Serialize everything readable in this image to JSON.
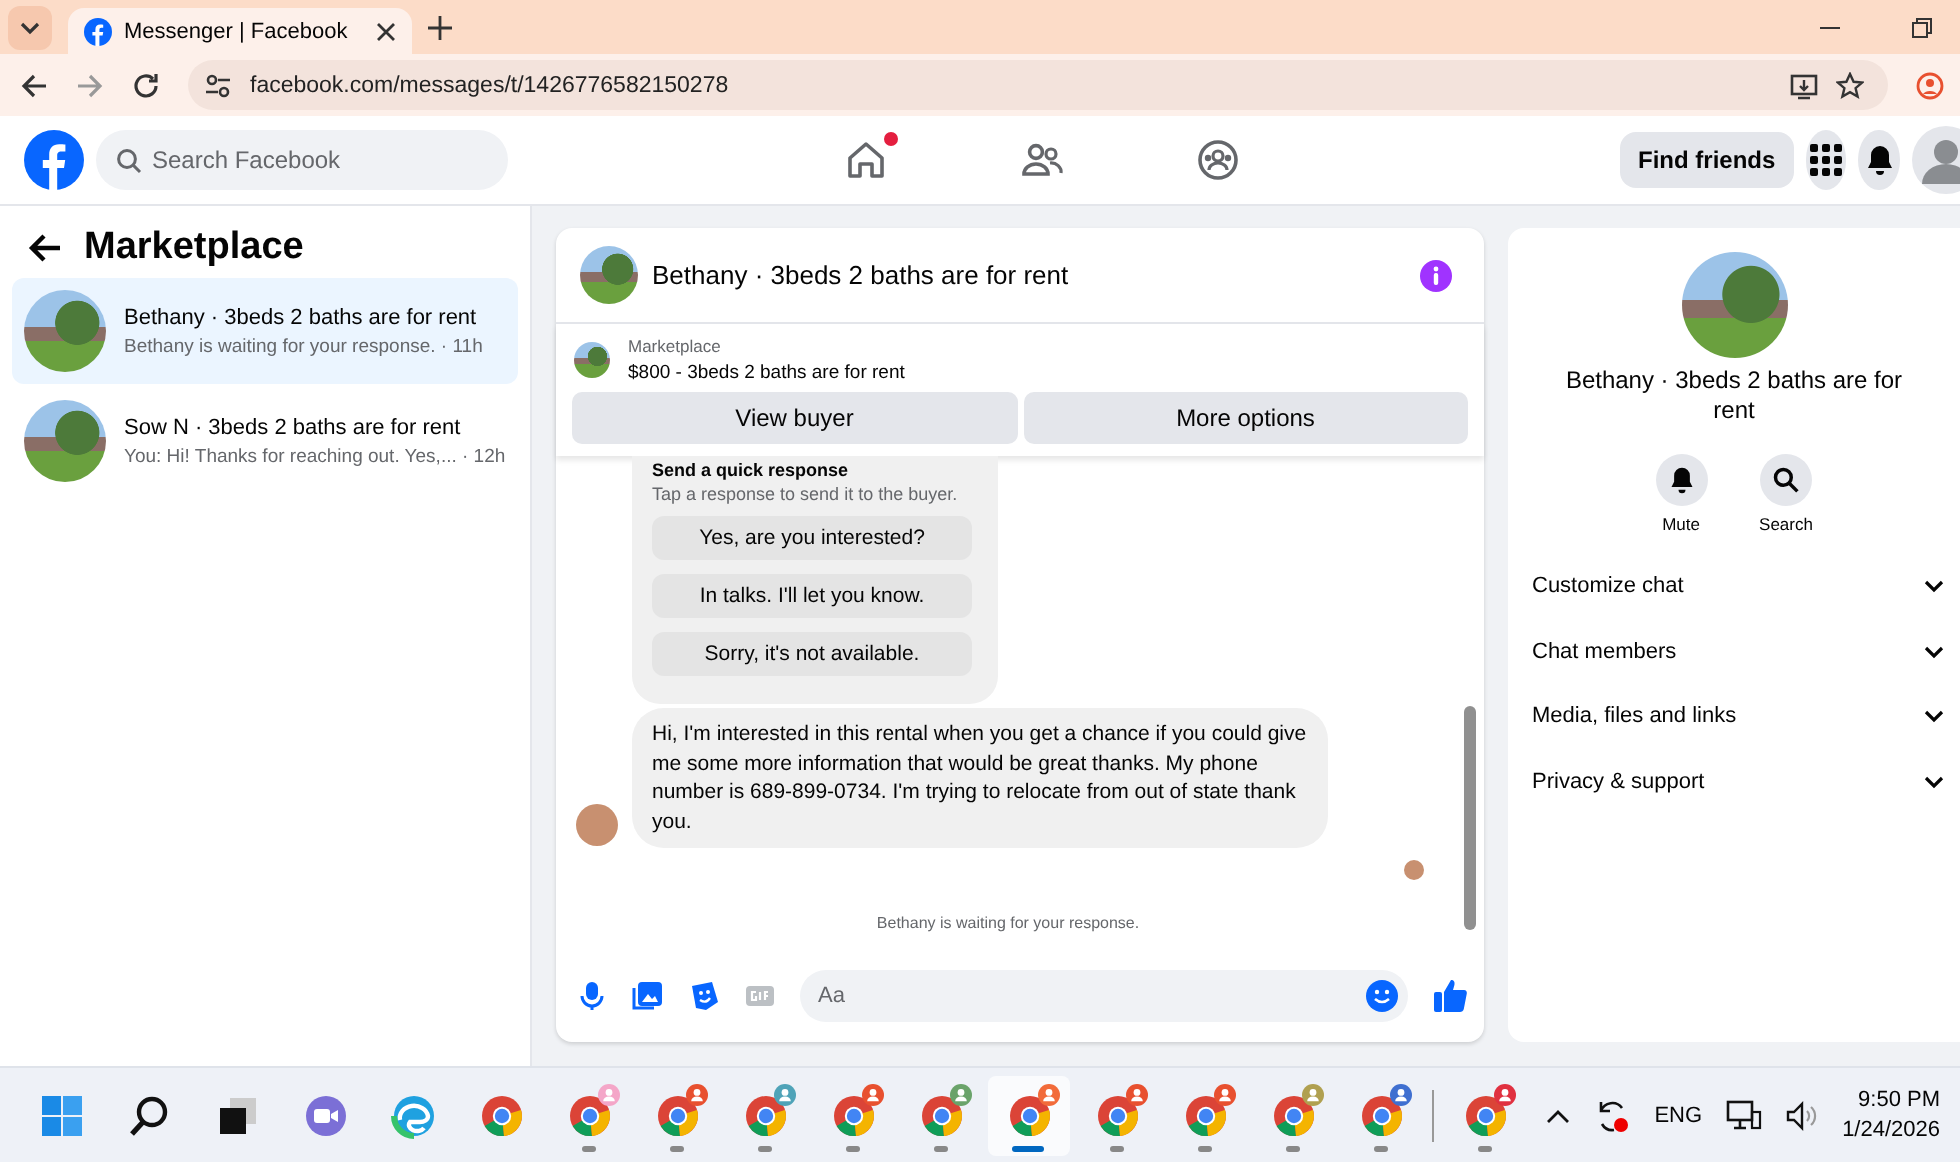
{
  "browser": {
    "tab": {
      "title": "Messenger | Facebook"
    },
    "url": "facebook.com/messages/t/1426776582150278"
  },
  "header": {
    "search": {
      "placeholder": "Search Facebook"
    },
    "nav": [
      {
        "kind": "home",
        "notification": true
      },
      {
        "kind": "friends",
        "notification": false
      },
      {
        "kind": "groups",
        "notification": false
      }
    ],
    "find_friends": "Find friends"
  },
  "sidebar": {
    "title": "Marketplace",
    "conversations": [
      {
        "name": "Bethany · 3beds 2 baths are for rent",
        "preview": "Bethany is waiting for your response. · 11h",
        "selected": true
      },
      {
        "name": "Sow N · 3beds 2 baths are for rent",
        "preview": "You: Hi! Thanks for reaching out. Yes,... · 12h",
        "selected": false
      }
    ]
  },
  "chat": {
    "title": "Bethany · 3beds 2 baths are for rent",
    "listing": {
      "label": "Marketplace",
      "item": "$800 - 3beds 2 baths are for rent",
      "buttons": [
        "View buyer",
        "More options"
      ]
    },
    "quick_response": {
      "title": "Send a quick response",
      "hint": "Tap a response to send it to the buyer.",
      "options": [
        "Yes, are you interested?",
        "In talks. I'll let you know.",
        "Sorry, it's not available."
      ]
    },
    "message": "Hi, I'm interested in this rental when you get a chance if you could give me some more information that would be great thanks. My phone number is 689-899-0734. I'm trying to relocate from out of state thank you.",
    "status": "Bethany is waiting for your response.",
    "composer": {
      "placeholder": "Aa"
    }
  },
  "details": {
    "title": "Bethany · 3beds 2 baths are for rent",
    "actions": [
      {
        "kind": "mute",
        "label": "Mute"
      },
      {
        "kind": "search",
        "label": "Search"
      }
    ],
    "sections": [
      {
        "label": "Customize chat",
        "expanded": false
      },
      {
        "label": "Chat members",
        "expanded": false
      },
      {
        "label": "Media, files and links",
        "expanded": false
      },
      {
        "label": "Privacy & support",
        "expanded": false
      }
    ]
  },
  "taskbar": {
    "apps": [
      {
        "kind": "windows",
        "running": false,
        "selected": false
      },
      {
        "kind": "search",
        "running": false,
        "selected": false
      },
      {
        "kind": "taskview",
        "running": false,
        "selected": false
      },
      {
        "kind": "teams",
        "running": false,
        "selected": false
      },
      {
        "kind": "edge",
        "running": false,
        "selected": false
      },
      {
        "kind": "chrome",
        "running": false,
        "selected": false
      },
      {
        "kind": "chrome-profile",
        "color": "#f4a6c8",
        "running": true,
        "selected": false
      },
      {
        "kind": "chrome-profile",
        "color": "#e8502f",
        "running": true,
        "selected": false
      },
      {
        "kind": "chrome-profile",
        "color": "#4fa3b8",
        "running": true,
        "selected": false
      },
      {
        "kind": "chrome-profile",
        "color": "#e8502f",
        "running": true,
        "selected": false
      },
      {
        "kind": "chrome-profile",
        "color": "#6aa36a",
        "running": true,
        "selected": false
      },
      {
        "kind": "chrome-profile",
        "color": "#f26b3a",
        "running": true,
        "selected": true
      },
      {
        "kind": "chrome-profile",
        "color": "#e8502f",
        "running": true,
        "selected": false
      },
      {
        "kind": "chrome-profile",
        "color": "#e8502f",
        "running": true,
        "selected": false
      },
      {
        "kind": "chrome-profile",
        "color": "#b0a050",
        "running": true,
        "selected": false
      },
      {
        "kind": "chrome-profile",
        "color": "#3f6fd0",
        "running": true,
        "selected": false
      },
      {
        "kind": "chrome-profile",
        "color": "#e03040",
        "running": true,
        "selected": false
      }
    ],
    "language": "ENG",
    "time": "9:50 PM",
    "date": "1/24/2026"
  }
}
